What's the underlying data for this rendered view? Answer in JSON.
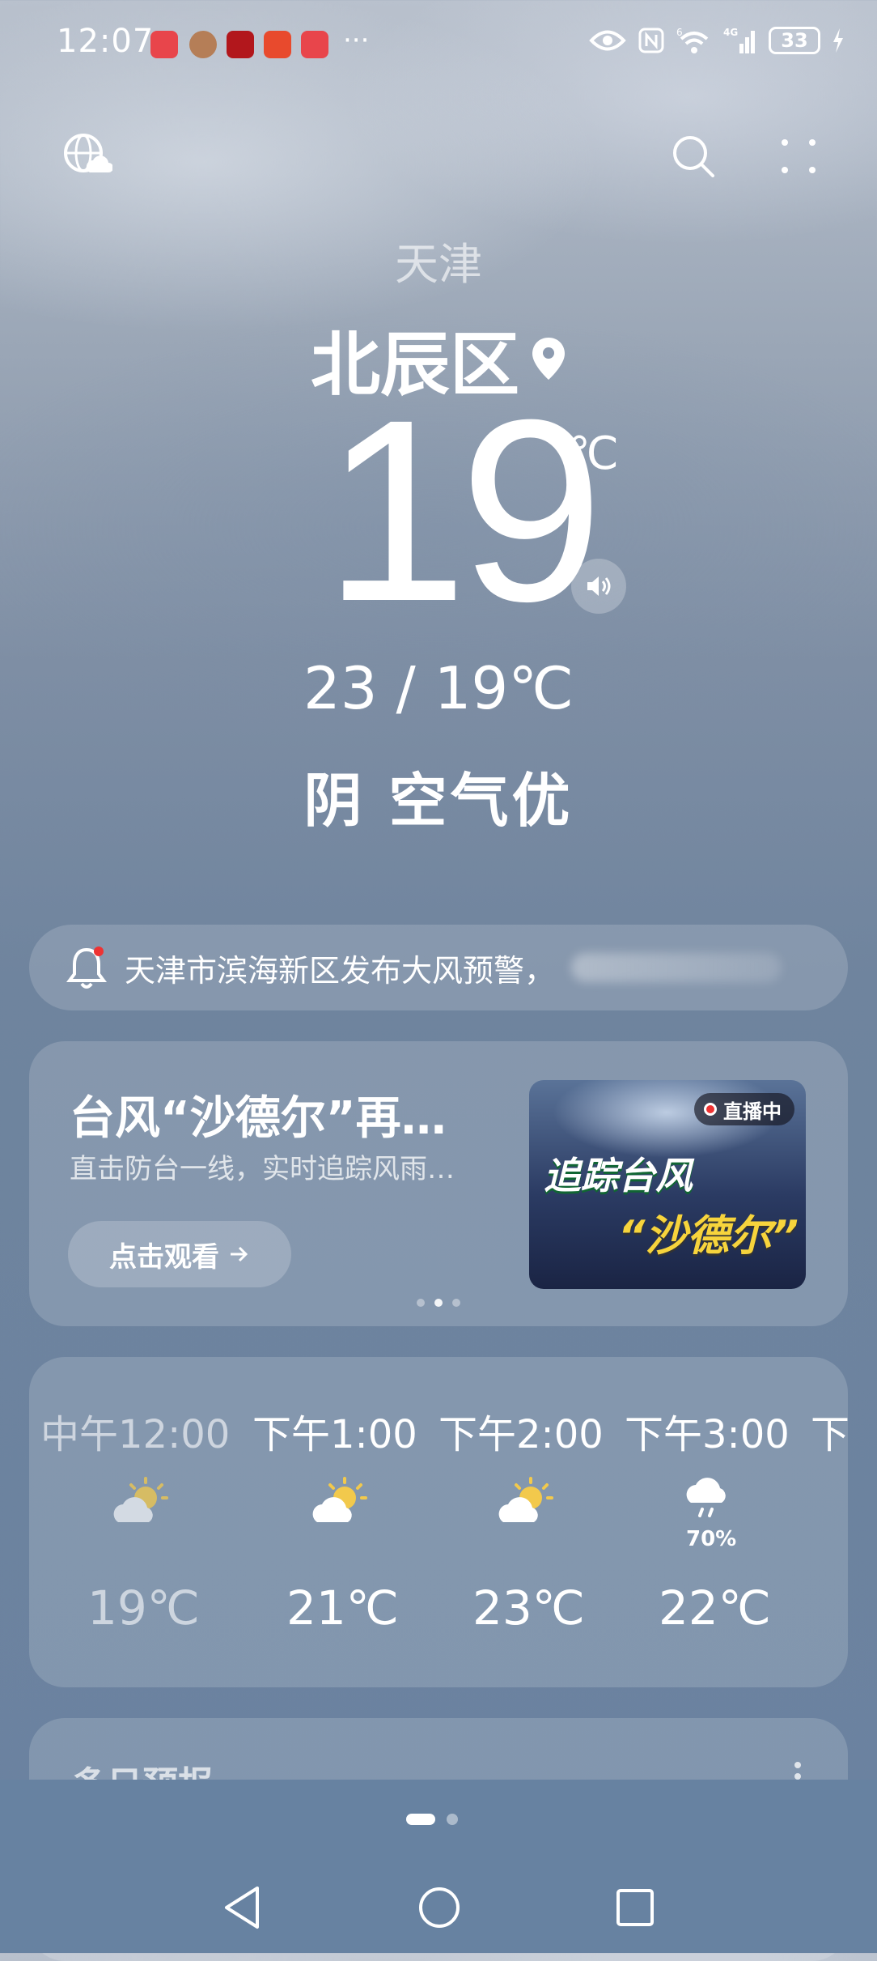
{
  "status_bar": {
    "time": "12:07",
    "battery": "33",
    "network": "4G",
    "wifi_badge": "6"
  },
  "location": {
    "city": "天津",
    "district": "北辰区"
  },
  "current": {
    "temperature": "19",
    "unit": "℃",
    "range": "23 / 19℃",
    "condition": "阴 空气优"
  },
  "alert": {
    "text": "天津市滨海新区发布大风预警，"
  },
  "video_card": {
    "title": "台风“沙德尔”再…",
    "subtitle": "直击防台一线，实时追踪风雨…",
    "button_label": "点击观看",
    "live_badge": "直播中",
    "thumb_line1": "追踪台风",
    "thumb_line2": "“沙德尔”",
    "carousel_active": 2
  },
  "hourly": [
    {
      "time": "中午12:00",
      "icon": "cloudy-sun-icon",
      "temp": "19℃",
      "current": true
    },
    {
      "time": "下午1:00",
      "icon": "cloudy-sun-icon",
      "temp": "21℃"
    },
    {
      "time": "下午2:00",
      "icon": "cloudy-sun-icon",
      "temp": "23℃"
    },
    {
      "time": "下午3:00",
      "icon": "rain-cloud-icon",
      "temp": "22℃",
      "precip": "70%"
    },
    {
      "time": "下",
      "icon": "",
      "temp": ""
    }
  ],
  "multi_day": {
    "title": "多日预报"
  },
  "colors": {
    "accent_yellow": "#f2c94c",
    "live_red": "#e33333"
  }
}
